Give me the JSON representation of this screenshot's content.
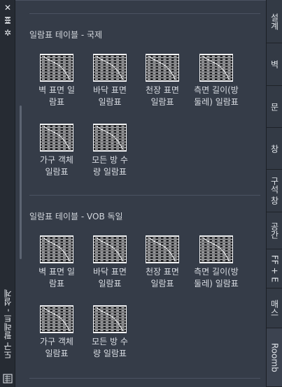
{
  "palette_title": "도구 팔레트 - 설계",
  "titlebar": {
    "close_glyph": "✕",
    "autohide_glyph": "⇄",
    "properties_glyph": "✲"
  },
  "groups": [
    {
      "title": "일람표 테이블 - 국제",
      "tools": [
        {
          "label": "벽 표면 일\n람표",
          "icon": "schedule-table-icon"
        },
        {
          "label": "바닥 표면\n일람표",
          "icon": "schedule-table-icon"
        },
        {
          "label": "천장 표면\n일람표",
          "icon": "schedule-table-icon"
        },
        {
          "label": "측면 길이(방\n둘레) 일람표",
          "icon": "schedule-table-icon"
        },
        {
          "label": "가구 객체\n일람표",
          "icon": "schedule-table-icon"
        },
        {
          "label": "모든 방 수\n량 일람표",
          "icon": "schedule-table-icon"
        }
      ]
    },
    {
      "title": "일람표 테이블 - VOB 독일",
      "tools": [
        {
          "label": "벽 표면 일\n람표",
          "icon": "schedule-table-icon"
        },
        {
          "label": "바닥 표면\n일람표",
          "icon": "schedule-table-icon"
        },
        {
          "label": "천장 표면\n일람표",
          "icon": "schedule-table-icon"
        },
        {
          "label": "측면 길이(방\n둘레) 일람표",
          "icon": "schedule-table-icon"
        },
        {
          "label": "가구 객체\n일람표",
          "icon": "schedule-table-icon"
        },
        {
          "label": "모든 방 수\n량 일람표",
          "icon": "schedule-table-icon"
        }
      ]
    }
  ],
  "tabs": [
    {
      "label": "설계",
      "active": false
    },
    {
      "label": "벽",
      "active": false
    },
    {
      "label": "문",
      "active": false
    },
    {
      "label": "창",
      "active": false
    },
    {
      "label": "구석 창",
      "active": false
    },
    {
      "label": "공간",
      "active": false
    },
    {
      "label": "FF + E",
      "active": false
    },
    {
      "label": "매스",
      "active": false
    },
    {
      "label": "Roomb",
      "active": true
    }
  ],
  "colors": {
    "background": "#353c48",
    "tab_active": "#3c4350",
    "text": "#d8dce2"
  }
}
